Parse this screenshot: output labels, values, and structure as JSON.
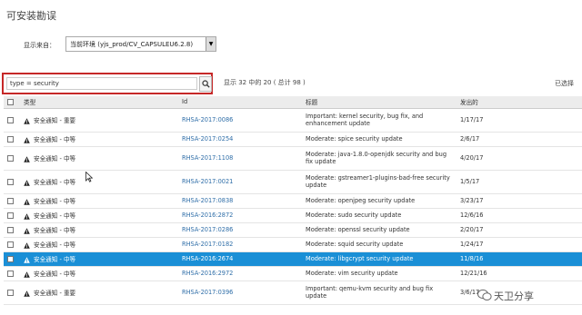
{
  "page": {
    "title": "可安装勘误"
  },
  "filter": {
    "source_label": "显示来自：",
    "env_value": "当前环境 (yjs_prod/CV_CAPSULEU6.2.8)",
    "search_value": "type = security"
  },
  "paging": {
    "info": "显示 32 中的 20 ( 总计 98 )",
    "selected": "已选择"
  },
  "table": {
    "headers": [
      "类型",
      "Id",
      "标题",
      "发出的"
    ],
    "rows": [
      {
        "type": "安全通知 - 重要",
        "id": "RHSA-2017:0086",
        "title": "Important: kernel security, bug fix, and enhancement update",
        "date": "1/17/17",
        "selected": false
      },
      {
        "type": "安全通知 - 中等",
        "id": "RHSA-2017:0254",
        "title": "Moderate: spice security update",
        "date": "2/6/17",
        "selected": false
      },
      {
        "type": "安全通知 - 中等",
        "id": "RHSA-2017:1108",
        "title": "Moderate: java-1.8.0-openjdk security and bug fix update",
        "date": "4/20/17",
        "selected": false
      },
      {
        "type": "安全通知 - 中等",
        "id": "RHSA-2017:0021",
        "title": "Moderate: gstreamer1-plugins-bad-free security update",
        "date": "1/5/17",
        "selected": false
      },
      {
        "type": "安全通知 - 中等",
        "id": "RHSA-2017:0838",
        "title": "Moderate: openjpeg security update",
        "date": "3/23/17",
        "selected": false
      },
      {
        "type": "安全通知 - 中等",
        "id": "RHSA-2016:2872",
        "title": "Moderate: sudo security update",
        "date": "12/6/16",
        "selected": false
      },
      {
        "type": "安全通知 - 中等",
        "id": "RHSA-2017:0286",
        "title": "Moderate: openssl security update",
        "date": "2/20/17",
        "selected": false
      },
      {
        "type": "安全通知 - 中等",
        "id": "RHSA-2017:0182",
        "title": "Moderate: squid security update",
        "date": "1/24/17",
        "selected": false
      },
      {
        "type": "安全通知 - 中等",
        "id": "RHSA-2016:2674",
        "title": "Moderate: libgcrypt security update",
        "date": "11/8/16",
        "selected": true
      },
      {
        "type": "安全通知 - 中等",
        "id": "RHSA-2016:2972",
        "title": "Moderate: vim security update",
        "date": "12/21/16",
        "selected": false
      },
      {
        "type": "安全通知 - 重要",
        "id": "RHSA-2017:0396",
        "title": "Important: qemu-kvm security and bug fix update",
        "date": "3/6/17",
        "selected": false
      }
    ]
  },
  "watermark": {
    "text": "天卫分享"
  }
}
